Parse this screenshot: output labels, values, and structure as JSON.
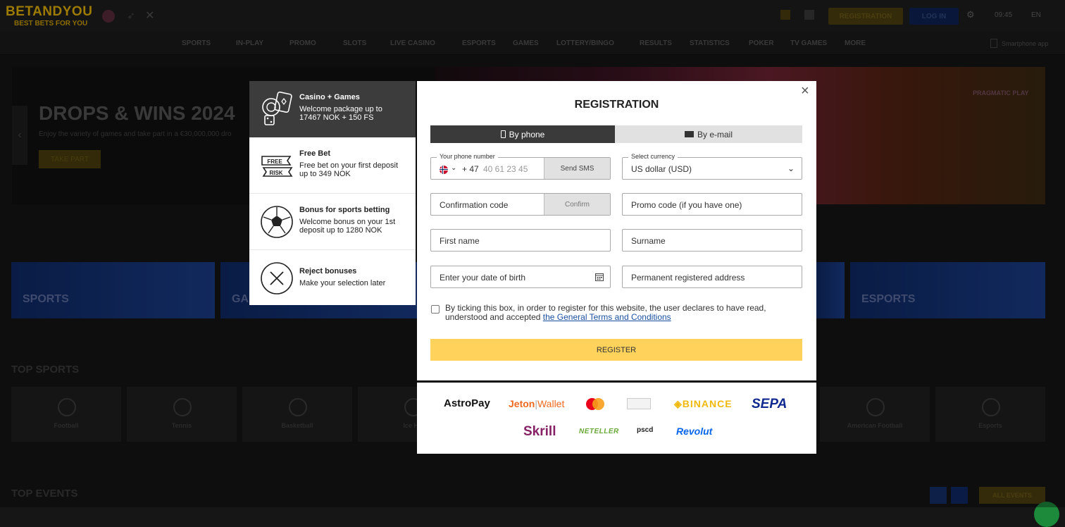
{
  "header": {
    "logo": "BETANDYOU",
    "logo_tagline": "BEST BETS FOR YOU",
    "registration_label": "REGISTRATION",
    "login_label": "LOG IN",
    "time": "09:45",
    "language": "EN",
    "app_label": "Smartphone app"
  },
  "nav": {
    "items": [
      "SPORTS",
      "IN-PLAY",
      "PROMO",
      "SLOTS",
      "LIVE CASINO",
      "ESPORTS",
      "GAMES",
      "LOTTERY/BINGO",
      "RESULTS",
      "STATISTICS",
      "POKER",
      "TV GAMES",
      "MORE"
    ]
  },
  "banner": {
    "title": "DROPS & WINS 2024",
    "subtitle": "Enjoy the variety of games and take part in a €30,000,000 dro",
    "button": "TAKE PART",
    "brand": "PRAGMATIC PLAY"
  },
  "categories": [
    "SPORTS",
    "GA",
    "ESPORTS"
  ],
  "sections": {
    "top_sports": "TOP SPORTS",
    "top_events": "TOP EVENTS",
    "all_events": "ALL EVENTS"
  },
  "sports": [
    "Football",
    "Tennis",
    "Basketball",
    "Ice Ho",
    "American Football",
    "Esports"
  ],
  "bonuses": [
    {
      "title": "Casino + Games",
      "desc": "Welcome package up to 17467 NOK + 150 FS",
      "active": true
    },
    {
      "title": "Free Bet",
      "desc": "Free bet on your first deposit up to 349 NOK",
      "badge_top": "FREE",
      "badge_bottom": "RISK"
    },
    {
      "title": "Bonus for sports betting",
      "desc": "Welcome bonus on your 1st deposit up to 1280 NOK"
    },
    {
      "title": "Reject bonuses",
      "desc": "Make your selection later"
    }
  ],
  "registration": {
    "title": "REGISTRATION",
    "close": "×",
    "tab_phone": "By phone",
    "tab_email": "By e-mail",
    "phone_legend": "Your phone number",
    "phone_prefix": "+ 47",
    "phone_placeholder": "40 61 23 45",
    "send_sms": "Send SMS",
    "currency_legend": "Select currency",
    "currency_value": "US dollar (USD)",
    "confirmation_placeholder": "Confirmation code",
    "confirm": "Confirm",
    "promo_placeholder": "Promo code (if you have one)",
    "first_name_placeholder": "First name",
    "surname_placeholder": "Surname",
    "dob_placeholder": "Enter your date of birth",
    "address_placeholder": "Permanent registered address",
    "terms_text": "By ticking this box, in order to register for this website, the user declares to have read, understood and accepted ",
    "terms_link": "the General Terms and Conditions",
    "register_button": "REGISTER"
  },
  "payments": {
    "astropay": "AstroPay",
    "jeton": "Jeton",
    "wallet": "Wallet",
    "binance": "BINANCE",
    "sepa": "SEPA",
    "skrill": "Skrill",
    "neteller": "NETELLER",
    "pscd": "pscd",
    "revolut": "Revolut"
  },
  "colors": {
    "accent_yellow": "#ffd25c",
    "tab_dark": "#3a3a3a",
    "link_blue": "#1a4fa0",
    "sepa_blue": "#10298e",
    "skrill_purple": "#862165",
    "revolut_blue": "#0666eb",
    "binance_yellow": "#f0b90b",
    "jeton_orange": "#ef6a1f"
  }
}
